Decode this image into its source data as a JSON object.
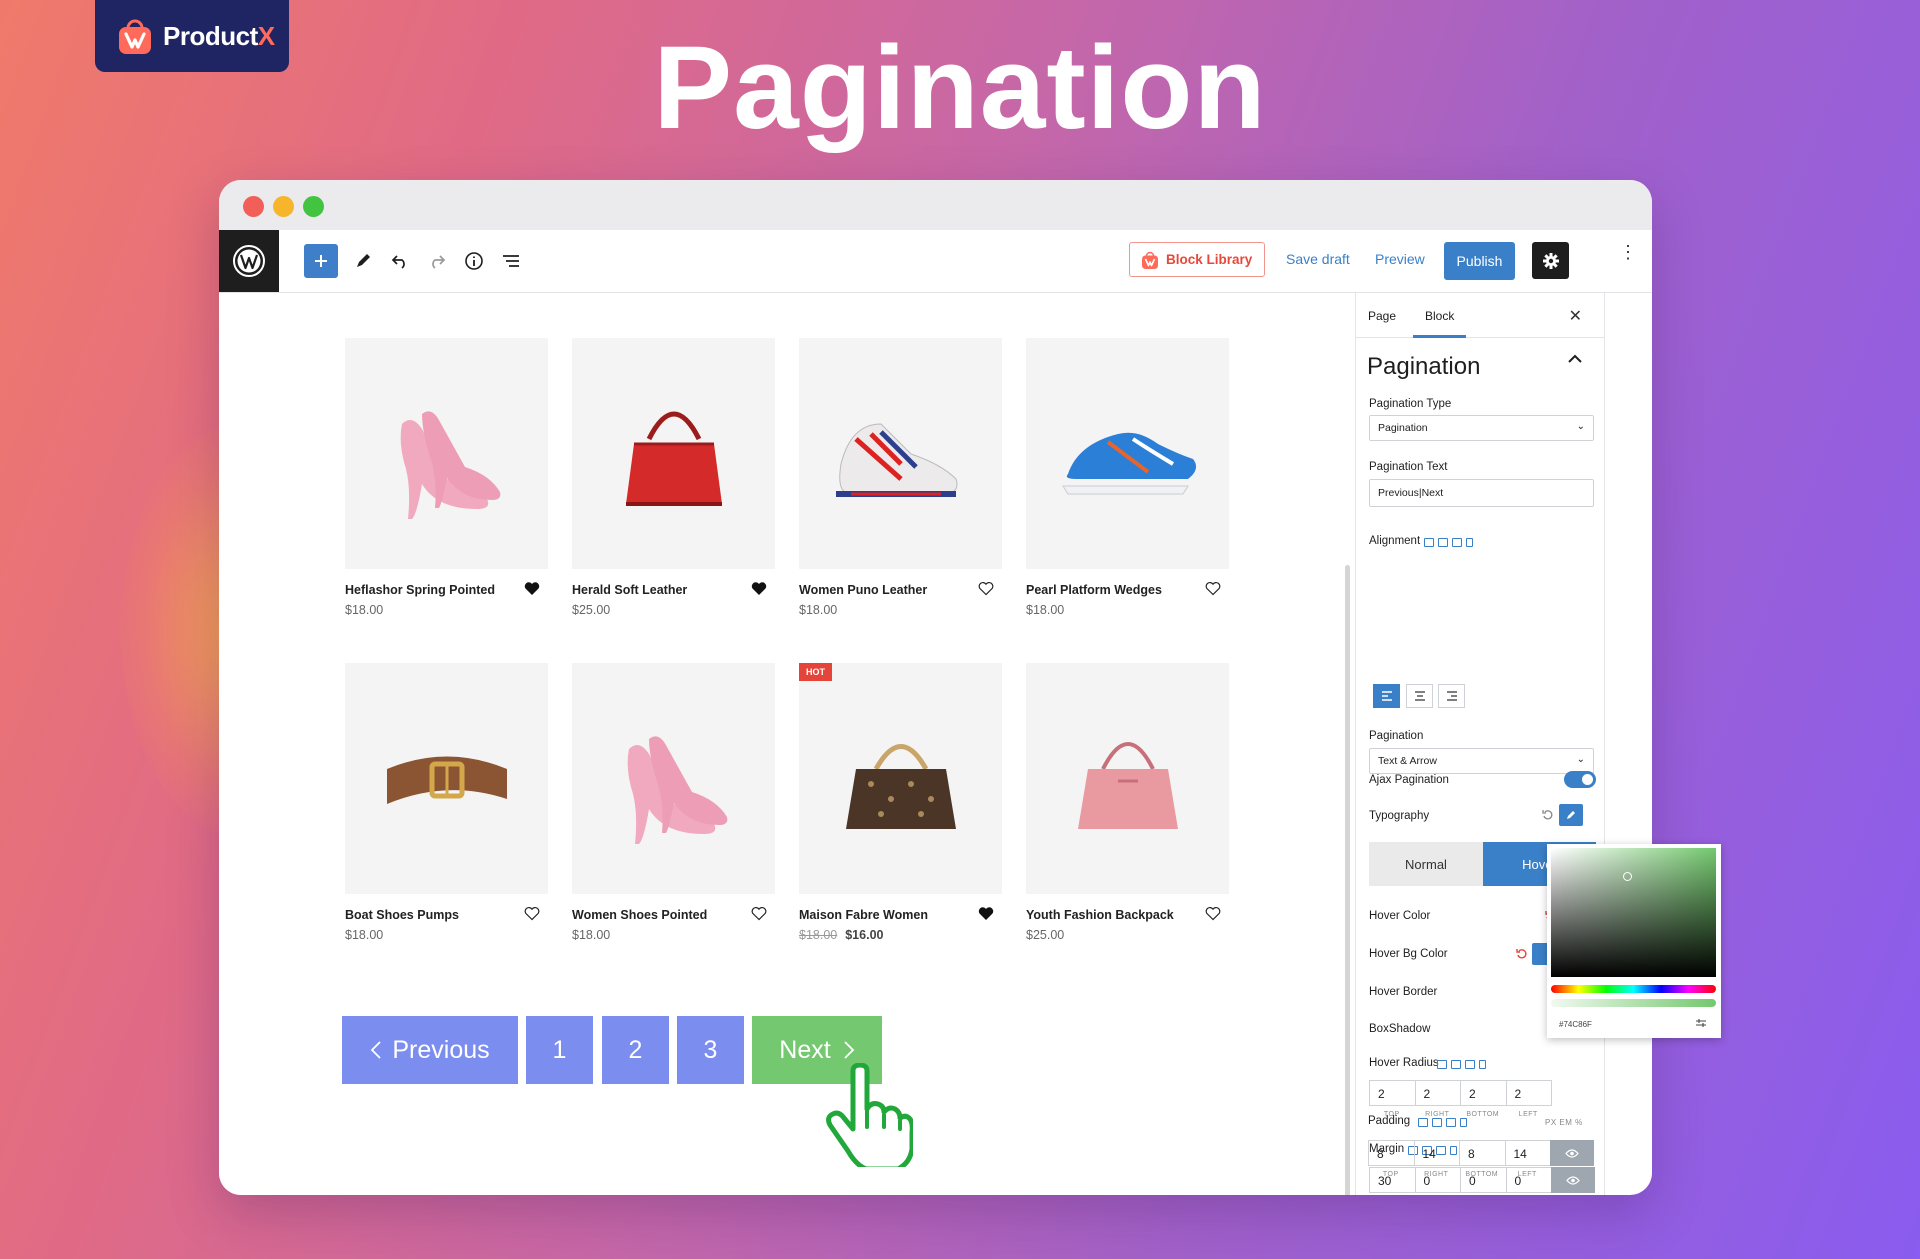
{
  "brand": {
    "name_main": "Product",
    "name_accent": "X",
    "accent": "#ff6a5a",
    "bg": "#1f2463"
  },
  "headline": "Pagination",
  "toolbar": {
    "block_library": "Block Library",
    "save_draft": "Save draft",
    "preview": "Preview",
    "publish": "Publish",
    "accent": "#3a80c8"
  },
  "products": [
    {
      "name": "Heflashor Spring Pointed",
      "price": "$18.00",
      "liked": true,
      "icon": "pink-heels"
    },
    {
      "name": "Herald Soft Leather",
      "price": "$25.00",
      "liked": true,
      "icon": "red-handbag"
    },
    {
      "name": "Women Puno Leather",
      "price": "$18.00",
      "liked": false,
      "icon": "running-sneakers"
    },
    {
      "name": "Pearl Platform Wedges",
      "price": "$18.00",
      "liked": false,
      "icon": "blue-sneaker"
    },
    {
      "name": "Boat Shoes Pumps",
      "price": "$18.00",
      "liked": false,
      "icon": "leather-belt"
    },
    {
      "name": "Women Shoes Pointed",
      "price": "$18.00",
      "liked": false,
      "icon": "pink-heels"
    },
    {
      "name": "Maison Fabre Women",
      "price_old": "$18.00",
      "price": "$16.00",
      "liked": true,
      "badge": "HOT",
      "icon": "monogram-bag"
    },
    {
      "name": "Youth Fashion Backpack",
      "price": "$25.00",
      "liked": false,
      "icon": "pink-handbag"
    }
  ],
  "pagination": {
    "previous": "Previous",
    "pages": [
      "1",
      "2",
      "3"
    ],
    "next": "Next",
    "button_color": "#7c8df0",
    "hover_color": "#74c86f"
  },
  "panel": {
    "tabs": [
      "Page",
      "Block"
    ],
    "active_tab": "Block",
    "title": "Pagination",
    "pagination_type_label": "Pagination Type",
    "pagination_type_value": "Pagination",
    "pagination_text_label": "Pagination Text",
    "pagination_text_value": "Previous|Next",
    "alignment_label": "Alignment",
    "pagination_label": "Pagination",
    "pagination_value": "Text & Arrow",
    "ajax_label": "Ajax Pagination",
    "ajax_enabled": true,
    "typography_label": "Typography",
    "state_normal": "Normal",
    "state_hover": "Hover",
    "hover_color_label": "Hover Color",
    "hover_bg_label": "Hover Bg Color",
    "hover_border_label": "Hover Border",
    "boxshadow_label": "BoxShadow",
    "hover_radius_label": "Hover Radius",
    "hover_radius": [
      "2",
      "2",
      "2",
      "2"
    ],
    "margin_label": "Margin",
    "margin": [
      "30",
      "0",
      "0",
      "0"
    ],
    "padding_label": "Padding",
    "padding": [
      "8",
      "14",
      "8",
      "14"
    ],
    "sides": [
      "TOP",
      "RIGHT",
      "BOTTOM",
      "LEFT"
    ],
    "units": "PX EM %"
  },
  "color_picker": {
    "hex": "#74C86F"
  }
}
